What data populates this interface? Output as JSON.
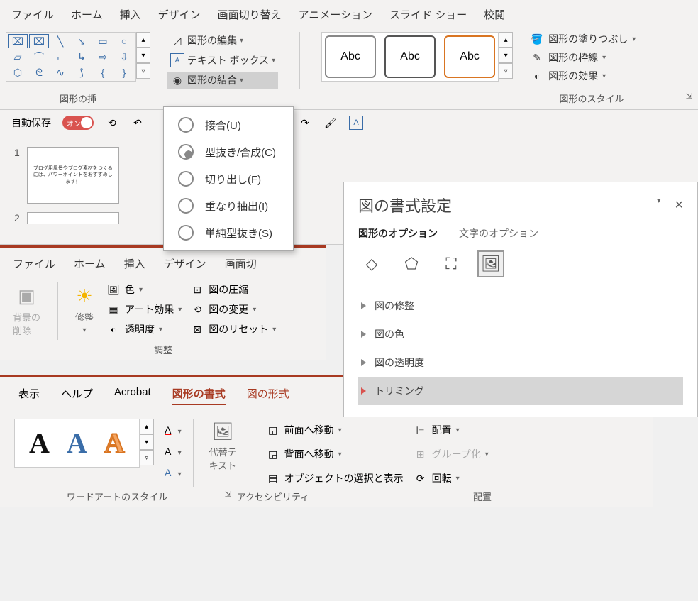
{
  "section1": {
    "tabs": [
      "ファイル",
      "ホーム",
      "挿入",
      "デザイン",
      "画面切り替え",
      "アニメーション",
      "スライド ショー",
      "校閲"
    ],
    "shape_edit": "図形の編集",
    "textbox": "テキスト ボックス",
    "shape_merge": "図形の結合",
    "group_insert": "図形の挿",
    "abc": "Abc",
    "group_style": "図形のスタイル",
    "fill": "図形の塗りつぶし",
    "outline": "図形の枠線",
    "effects": "図形の効果",
    "autosave": "自動保存",
    "autosave_state": "オン",
    "dropdown": [
      "接合(U)",
      "型抜き/合成(C)",
      "切り出し(F)",
      "重なり抽出(I)",
      "単純型抜き(S)"
    ],
    "slides": [
      {
        "num": "1",
        "text": "ブログ用風景やブログ素材をつくるには、パワーポイントをおすすめします！"
      },
      {
        "num": "2",
        "text": ""
      }
    ]
  },
  "section2": {
    "tabs": [
      "ファイル",
      "ホーム",
      "挿入",
      "デザイン",
      "画面切"
    ],
    "remove_bg": "背景の\n削除",
    "adjust": "修整",
    "color": "色",
    "art": "アート効果",
    "trans": "透明度",
    "compress": "図の圧縮",
    "change": "図の変更",
    "reset": "図のリセット",
    "group": "調整"
  },
  "pane": {
    "title": "図の書式設定",
    "tab1": "図形のオプション",
    "tab2": "文字のオプション",
    "rows": [
      "図の修整",
      "図の色",
      "図の透明度",
      "トリミング"
    ]
  },
  "section3": {
    "tabs": [
      "表示",
      "ヘルプ",
      "Acrobat",
      "図形の書式",
      "図の形式"
    ],
    "alt_text": "代替テ\nキスト",
    "forward": "前面へ移動",
    "backward": "背面へ移動",
    "select": "オブジェクトの選択と表示",
    "align": "配置",
    "group": "グループ化",
    "rotate": "回転",
    "g_wordart": "ワードアートのスタイル",
    "g_acc": "アクセシビリティ",
    "g_arrange": "配置",
    "A": "A"
  }
}
